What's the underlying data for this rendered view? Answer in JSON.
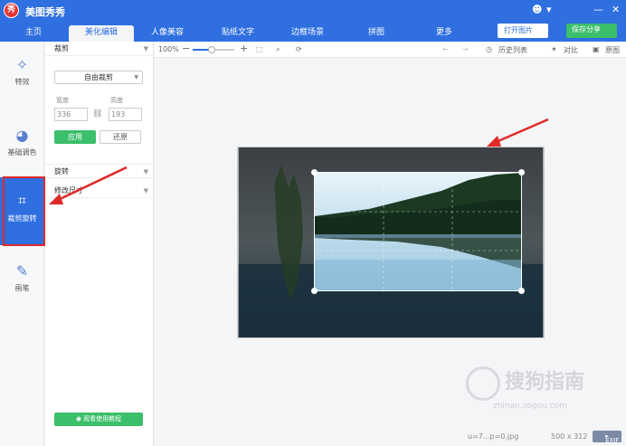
{
  "app": {
    "title": "美图秀秀",
    "logo_glyph": "秀"
  },
  "window": {
    "skin_glyph": "☻",
    "menu_glyph": "▾",
    "min_glyph": "—",
    "close_glyph": "✕"
  },
  "tabs": [
    {
      "label": "主页"
    },
    {
      "label": "美化编辑"
    },
    {
      "label": "人像美容"
    },
    {
      "label": "贴纸文字"
    },
    {
      "label": "边框场景"
    },
    {
      "label": "拼图"
    },
    {
      "label": "更多"
    }
  ],
  "top_buttons": {
    "open": "打开图片",
    "save": "保存分享"
  },
  "sidebar": {
    "items": [
      {
        "label": "特效",
        "icon": "magic-wand-icon",
        "glyph": "✧"
      },
      {
        "label": "基础调色",
        "icon": "palette-icon",
        "glyph": "◕"
      },
      {
        "label": "裁剪旋转",
        "icon": "crop-icon",
        "glyph": "⌗"
      },
      {
        "label": "画笔",
        "icon": "brush-icon",
        "glyph": "✎"
      }
    ]
  },
  "panel": {
    "crop": {
      "heading": "裁剪",
      "ratio": "自由裁剪",
      "width_label": "宽度",
      "height_label": "高度",
      "width_placeholder": "336",
      "height_placeholder": "193",
      "apply": "应用",
      "reset": "还原"
    },
    "rotate_heading": "旋转",
    "resize_heading": "修改尺寸",
    "tutorial": "观看使用教程",
    "tutorial_glyph": "◉"
  },
  "canvas_toolbar": {
    "zoom": "100%",
    "zoom_level": 0.45,
    "history": "历史列表",
    "compare": "对比",
    "original": "原图"
  },
  "status": {
    "filename": "u=7...p=0.jpg",
    "size": "500 x 312",
    "exif": "EXIF"
  },
  "watermark": {
    "text": "搜狗指南",
    "site": "zhinan.sogou.com"
  },
  "colors": {
    "accent": "#2f6fe0",
    "green": "#3bbf6a",
    "highlight": "#e02a2a"
  }
}
